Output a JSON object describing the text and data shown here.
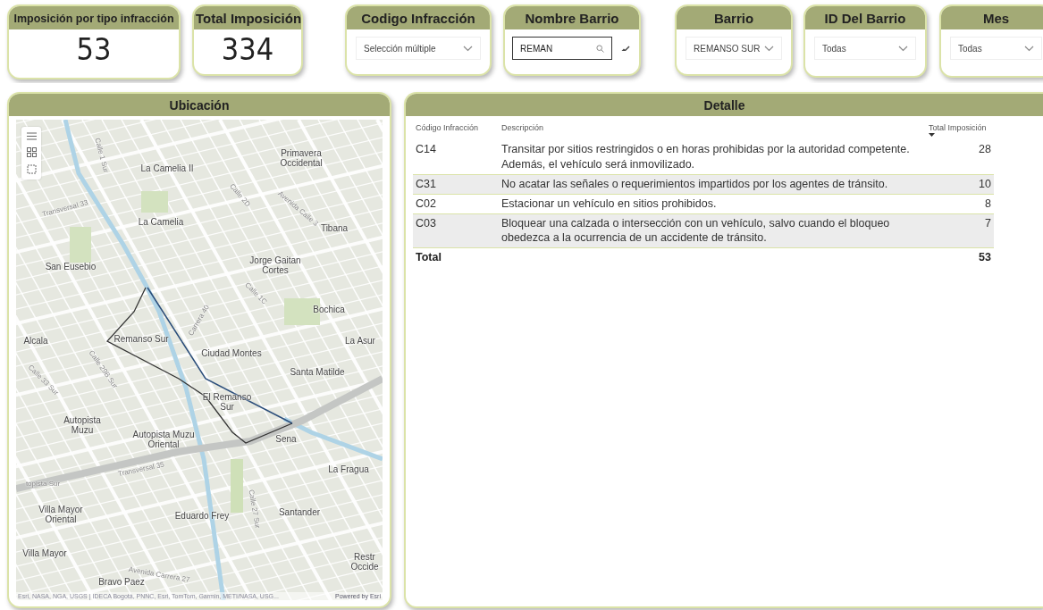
{
  "cards": [
    {
      "kind": "kpi",
      "title": "Imposición por tipo infracción",
      "value": "53"
    },
    {
      "kind": "kpi",
      "title": "Total Imposición",
      "value": "334"
    },
    {
      "kind": "dropdown",
      "title": "Codigo Infracción",
      "value": "Selección múltiple"
    },
    {
      "kind": "search",
      "title": "Nombre Barrio",
      "value": "REMAN"
    },
    {
      "kind": "dropdown",
      "title": "Barrio",
      "value": "REMANSO SUR"
    },
    {
      "kind": "dropdown",
      "title": "ID Del Barrio",
      "value": "Todas"
    },
    {
      "kind": "dropdown",
      "title": "Mes",
      "value": "Todas"
    }
  ],
  "map": {
    "title": "Ubicación",
    "labels": [
      {
        "kind": "place",
        "text": "La Camelia II"
      },
      {
        "kind": "place",
        "text": "Primavera\nOccidental"
      },
      {
        "kind": "place",
        "text": "La Camelia"
      },
      {
        "kind": "place",
        "text": "Tibana"
      },
      {
        "kind": "place",
        "text": "San Eusebio"
      },
      {
        "kind": "place",
        "text": "Jorge Gaitan\nCortes"
      },
      {
        "kind": "place",
        "text": "Bochica"
      },
      {
        "kind": "place",
        "text": "Alcala"
      },
      {
        "kind": "place",
        "text": "Remanso Sur"
      },
      {
        "kind": "place",
        "text": "Ciudad Montes"
      },
      {
        "kind": "place",
        "text": "La Asur"
      },
      {
        "kind": "place",
        "text": "Santa Matilde"
      },
      {
        "kind": "place",
        "text": "El Remanso\nSur"
      },
      {
        "kind": "place",
        "text": "Autopista\nMuzu"
      },
      {
        "kind": "place",
        "text": "Autopista Muzu\nOriental"
      },
      {
        "kind": "place",
        "text": "Sena"
      },
      {
        "kind": "place",
        "text": "La Fragua"
      },
      {
        "kind": "place",
        "text": "Villa Mayor\nOriental"
      },
      {
        "kind": "place",
        "text": "Eduardo Frey"
      },
      {
        "kind": "place",
        "text": "Santander"
      },
      {
        "kind": "place",
        "text": "Villa Mayor"
      },
      {
        "kind": "place",
        "text": "Restr\nOccide"
      },
      {
        "kind": "place",
        "text": "Bravo Paez"
      },
      {
        "kind": "street",
        "text": "Transversal 33"
      },
      {
        "kind": "street",
        "text": "Calle 1 Sur"
      },
      {
        "kind": "street",
        "text": "Avenida Calle 3"
      },
      {
        "kind": "street",
        "text": "Calle 2D"
      },
      {
        "kind": "street",
        "text": "Carrera 40"
      },
      {
        "kind": "street",
        "text": "Calle 1C"
      },
      {
        "kind": "street",
        "text": "Calle 33 Sur"
      },
      {
        "kind": "street",
        "text": "Calle 29B Sur"
      },
      {
        "kind": "street",
        "text": "Transversal 35"
      },
      {
        "kind": "street",
        "text": "Calle 27 Sur"
      },
      {
        "kind": "street",
        "text": "Avenida Carrera 27"
      },
      {
        "kind": "street",
        "text": "topista Sur"
      }
    ],
    "attribution": "Esri, NASA, NGA, USGS | IDECA Bogotá, PNNC, Esri, TomTom, Garmin, METI/NASA, USG...",
    "powered": "Powered by Esri"
  },
  "detail": {
    "title": "Detalle",
    "columns": [
      "Código Infracción",
      "Descripción",
      "Total Imposición"
    ],
    "rows": [
      {
        "code": "C14",
        "description": "Transitar por sitios restringidos o en horas prohibidas por la autoridad competente. Además, el vehículo será inmovilizado.",
        "total": "28"
      },
      {
        "code": "C31",
        "description": "No acatar las señales o requerimientos impartidos por los agentes de tránsito.",
        "total": "10"
      },
      {
        "code": "C02",
        "description": "Estacionar un vehículo en sitios prohibidos.",
        "total": "8"
      },
      {
        "code": "C03",
        "description": "Bloquear una calzada o intersección con un vehículo, salvo cuando el bloqueo obedezca a la ocurrencia de un accidente de tránsito.",
        "total": "7"
      }
    ],
    "total_label": "Total",
    "total_value": "53"
  }
}
